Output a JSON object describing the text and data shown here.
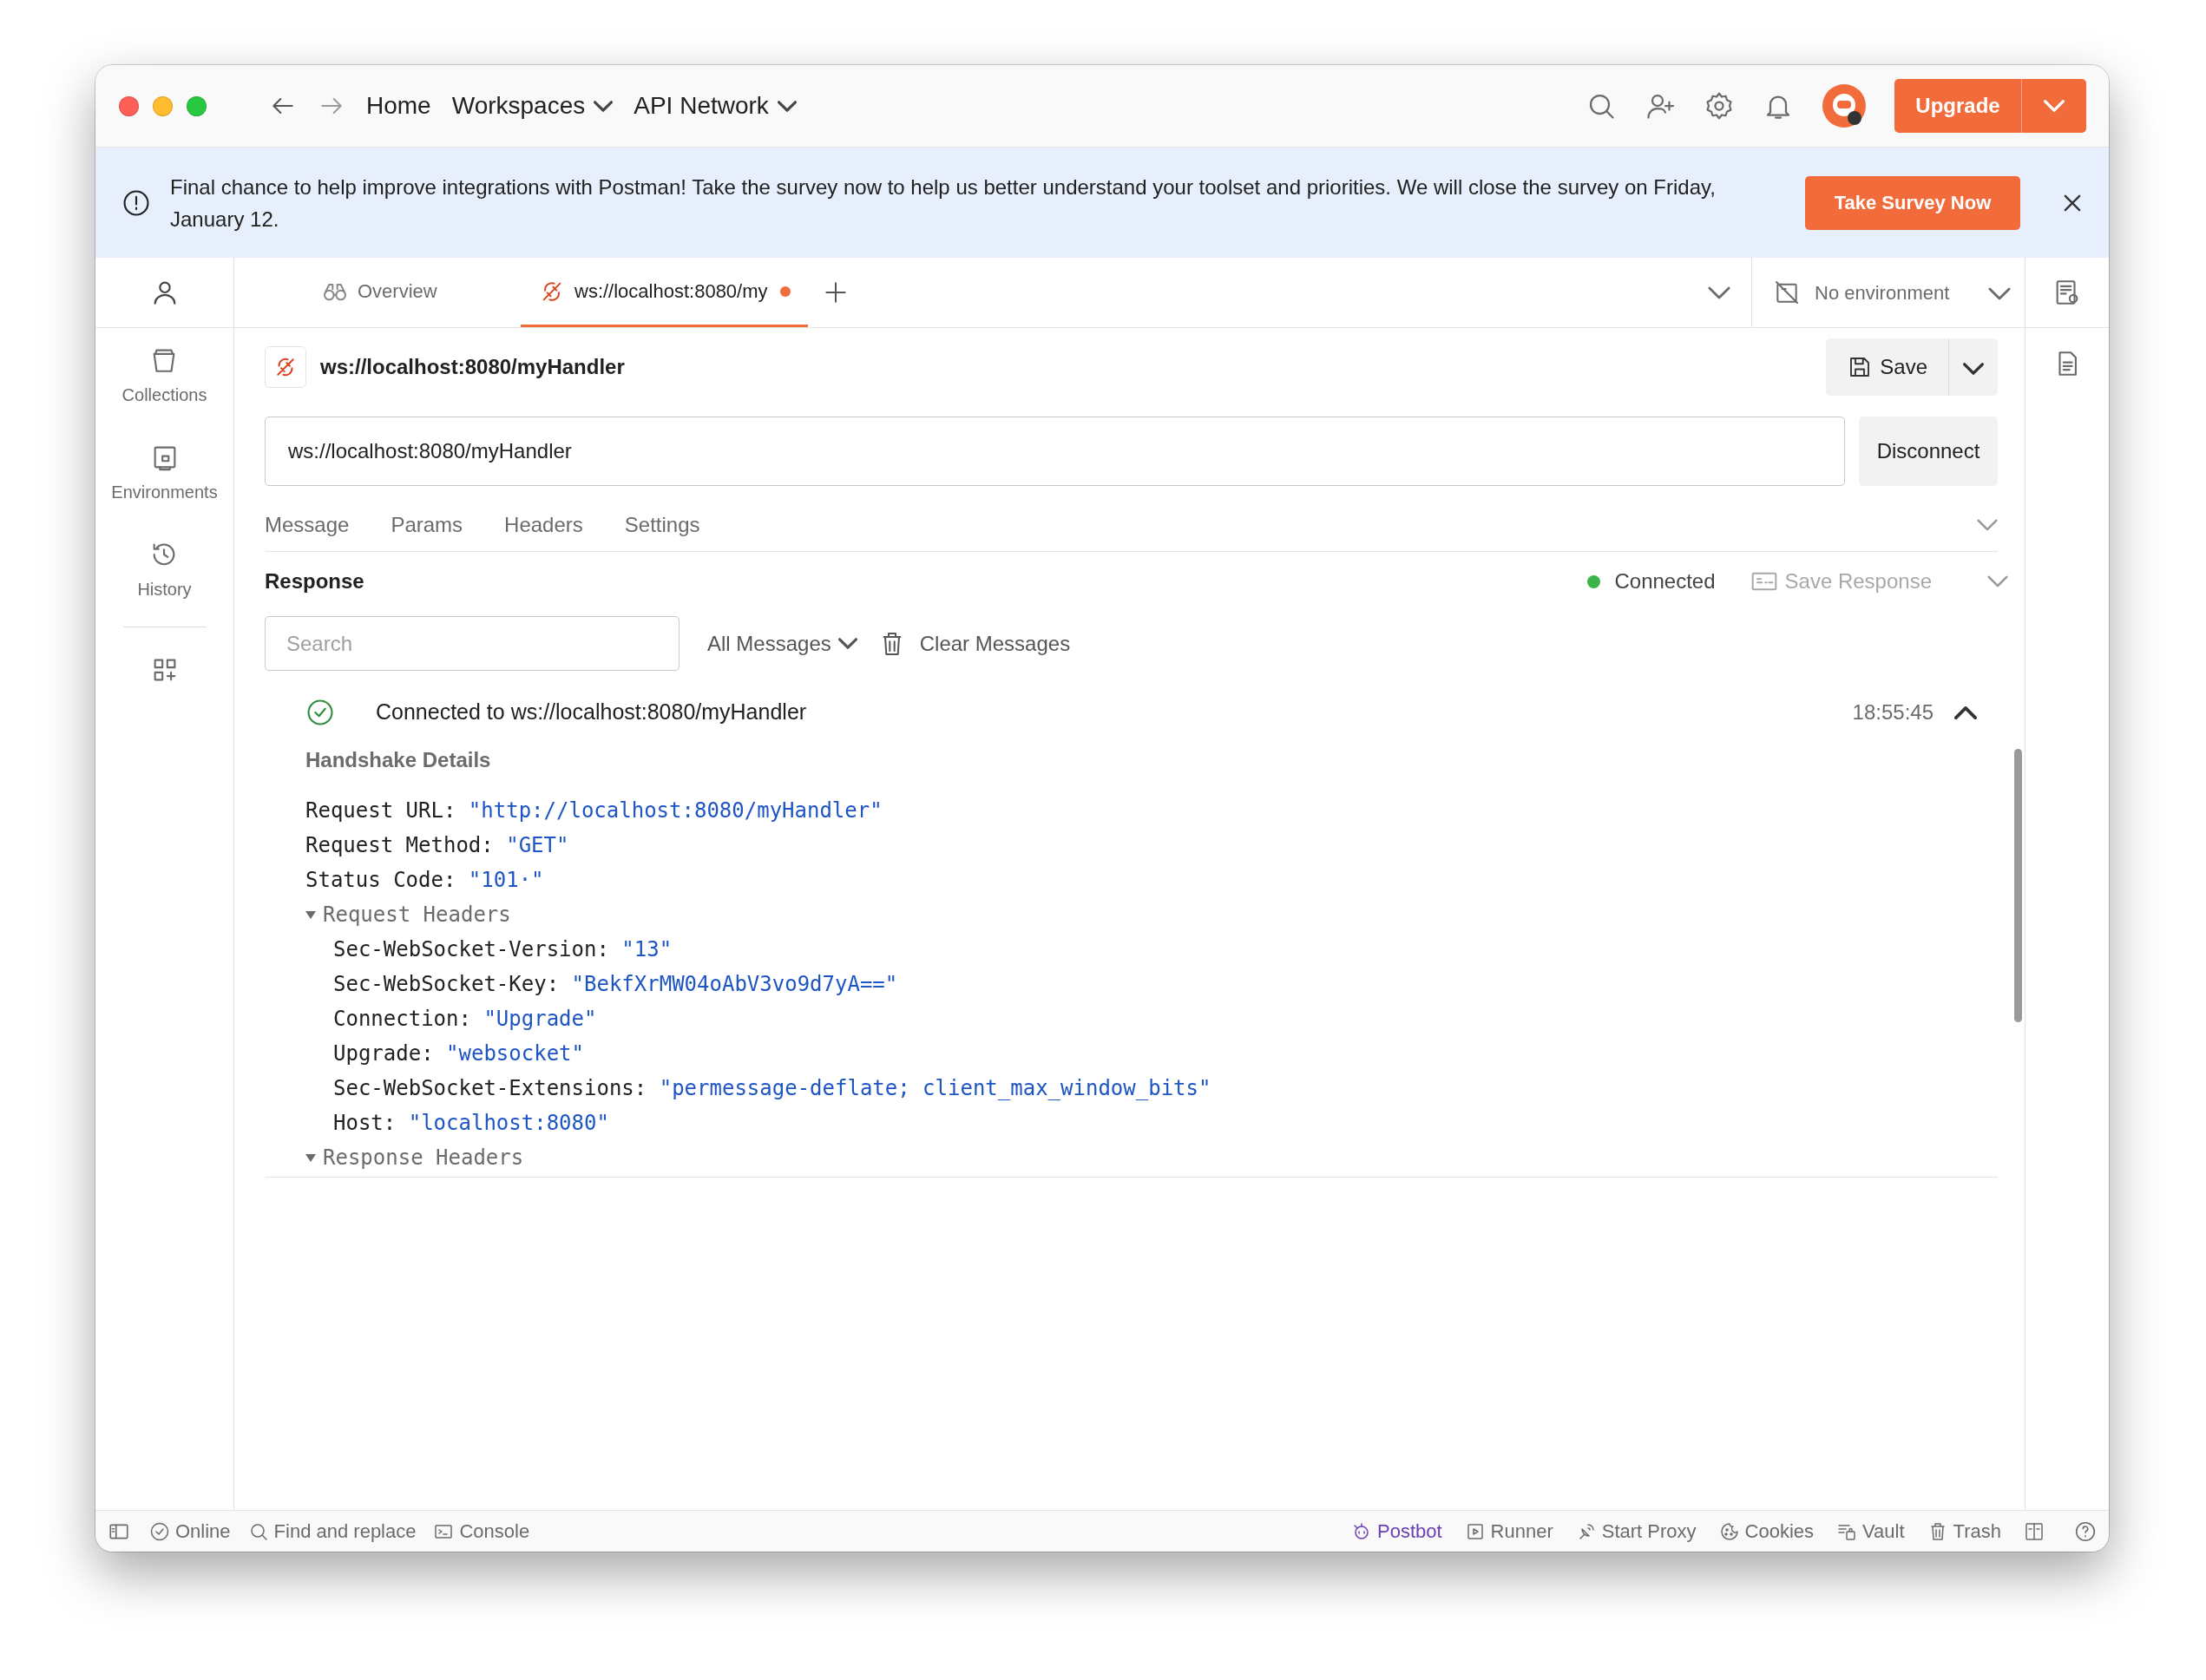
{
  "nav": {
    "items": [
      {
        "label": "Home",
        "menu": false
      },
      {
        "label": "Workspaces",
        "menu": true
      },
      {
        "label": "API Network",
        "menu": true
      }
    ],
    "upgrade": "Upgrade"
  },
  "banner": {
    "text": "Final chance to help improve integrations with Postman! Take the survey now to help us better understand your toolset and priorities. We will close the survey on Friday, January 12.",
    "button": "Take Survey Now"
  },
  "sidebar": {
    "items": [
      {
        "label": "Collections"
      },
      {
        "label": "Environments"
      },
      {
        "label": "History"
      }
    ]
  },
  "tabs": [
    {
      "label": "Overview",
      "selected": false,
      "unsaved": false
    },
    {
      "label": "ws://localhost:8080/my",
      "selected": true,
      "unsaved": true
    }
  ],
  "environment": {
    "label": "No environment"
  },
  "request": {
    "title": "ws://localhost:8080/myHandler",
    "save": "Save",
    "url": "ws://localhost:8080/myHandler",
    "connect_button": "Disconnect",
    "tabs": [
      "Message",
      "Params",
      "Headers",
      "Settings"
    ]
  },
  "response": {
    "title": "Response",
    "status": "Connected",
    "connected": true,
    "save_response": {
      "label": "Save Response",
      "disabled": true
    },
    "search": {
      "placeholder": "Search"
    },
    "filter": "All Messages",
    "clear": "Clear Messages",
    "messages": [
      {
        "text": "Connected to ws://localhost:8080/myHandler",
        "time": "18:55:45",
        "expanded": true,
        "details": {
          "title": "Handshake Details",
          "fields": [
            {
              "key": "Request URL:",
              "value": "\"http://localhost:8080/myHandler\""
            },
            {
              "key": "Request Method:",
              "value": "\"GET\""
            },
            {
              "key": "Status Code:",
              "value": "\"101·\""
            }
          ],
          "groups": [
            {
              "title": "Request Headers",
              "expanded": true,
              "fields": [
                {
                  "key": "Sec-WebSocket-Version:",
                  "value": "\"13\""
                },
                {
                  "key": "Sec-WebSocket-Key:",
                  "value": "\"BekfXrMW04oAbV3vo9d7yA==\""
                },
                {
                  "key": "Connection:",
                  "value": "\"Upgrade\""
                },
                {
                  "key": "Upgrade:",
                  "value": "\"websocket\""
                },
                {
                  "key": "Sec-WebSocket-Extensions:",
                  "value": "\"permessage-deflate; client_max_window_bits\""
                },
                {
                  "key": "Host:",
                  "value": "\"localhost:8080\""
                }
              ]
            },
            {
              "title": "Response Headers",
              "expanded": true
            }
          ]
        }
      }
    ]
  },
  "status_bar": {
    "left": [
      {
        "label": "Online"
      },
      {
        "label": "Find and replace"
      },
      {
        "label": "Console"
      }
    ],
    "right": [
      {
        "label": "Postbot",
        "accent": true
      },
      {
        "label": "Runner",
        "accent": false
      },
      {
        "label": "Start Proxy",
        "accent": false
      },
      {
        "label": "Cookies",
        "accent": false
      },
      {
        "label": "Vault",
        "accent": false
      },
      {
        "label": "Trash",
        "accent": false
      }
    ]
  }
}
